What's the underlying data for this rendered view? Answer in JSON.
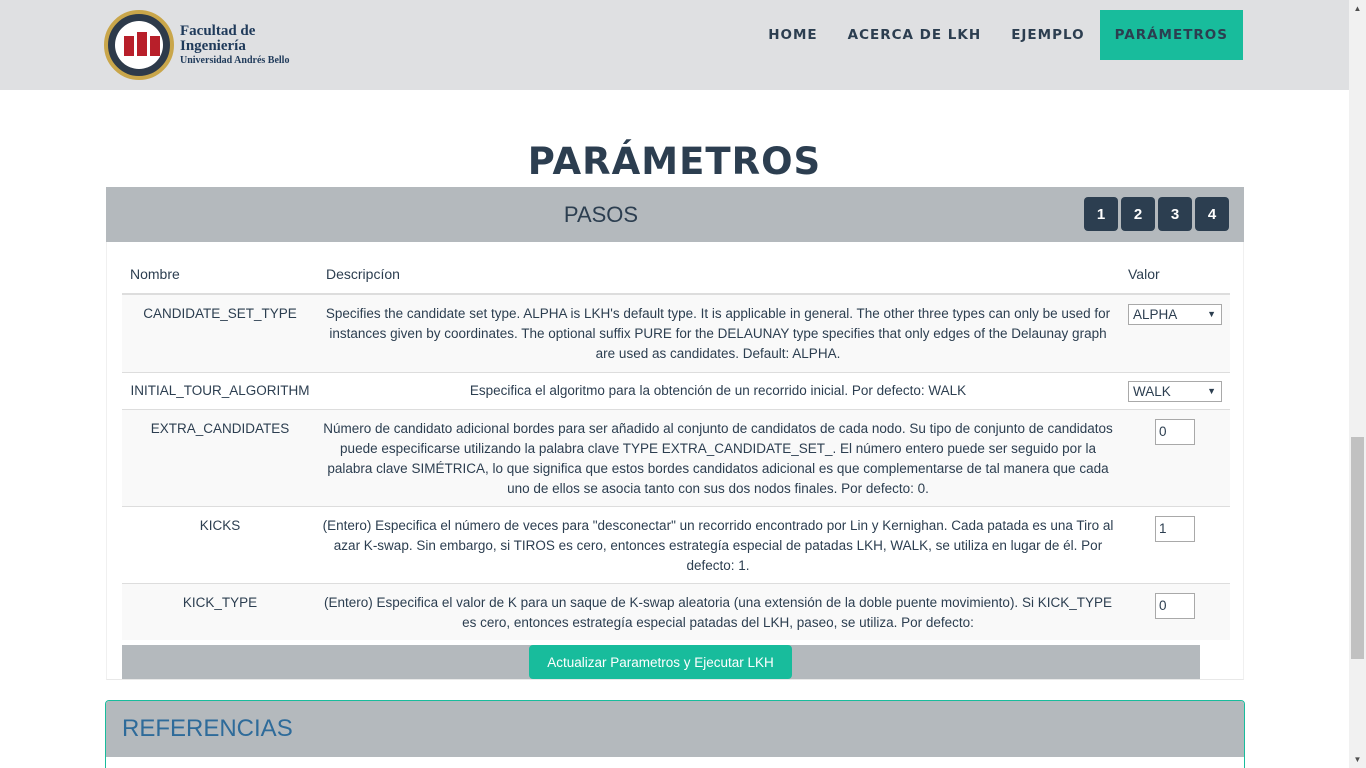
{
  "logo": {
    "line1": "Facultad de",
    "line2": "Ingeniería",
    "line3": "Universidad Andrés Bello"
  },
  "nav": {
    "items": [
      "HOME",
      "ACERCA DE LKH",
      "EJEMPLO",
      "PARÁMETROS"
    ],
    "active": "PARÁMETROS"
  },
  "page_title": "PARÁMETROS",
  "pasos": {
    "label": "PASOS",
    "steps": [
      "1",
      "2",
      "3",
      "4"
    ]
  },
  "table": {
    "headers": {
      "name": "Nombre",
      "desc": "Descripcíon",
      "value": "Valor"
    },
    "rows": [
      {
        "name": "CANDIDATE_SET_TYPE",
        "desc": "Specifies the candidate set type. ALPHA is LKH's default type. It is applicable in general. The other three types can only be used for instances given by coordinates. The optional suffix PURE for the DELAUNAY type specifies that only edges of the Delaunay graph are used as candidates. Default: ALPHA.",
        "value": "ALPHA"
      },
      {
        "name": "INITIAL_TOUR_ALGORITHM",
        "desc": "Especifica el algoritmo para la obtención de un recorrido inicial. Por defecto: WALK",
        "value": "WALK"
      },
      {
        "name": "EXTRA_CANDIDATES",
        "desc": "Número de candidato adicional bordes para ser añadido al conjunto de candidatos de cada nodo. Su tipo de conjunto de candidatos puede especificarse utilizando la palabra clave TYPE EXTRA_CANDIDATE_SET_. El número entero puede ser seguido por la palabra clave SIMÉTRICA, lo que significa que estos bordes candidatos adicional es que complementarse de tal manera que cada uno de ellos se asocia tanto con sus dos nodos finales. Por defecto: 0.",
        "value": "0"
      },
      {
        "name": "KICKS",
        "desc": "(Entero) Especifica el número de veces para \"desconectar\" un recorrido encontrado por Lin y Kernighan. Cada patada es una Tiro al azar K-swap. Sin embargo, si TIROS es cero, entonces estrategía especial de patadas LKH, WALK, se utiliza en lugar de él. Por defecto: 1.",
        "value": "1"
      },
      {
        "name": "KICK_TYPE",
        "desc": "(Entero) Especifica el valor de K para un saque de K-swap aleatoria (una extensión de la doble puente movimiento). Si KICK_TYPE es cero, entonces estrategía especial patadas del LKH, paseo, se utiliza. Por defecto:",
        "value": "0"
      }
    ]
  },
  "action_button": "Actualizar Parametros y Ejecutar LKH",
  "references": {
    "title": "REFERENCIAS"
  },
  "colors": {
    "accent": "#18bc9c",
    "navbar_bg": "#dfe0e2",
    "bar_bg": "#b4b9bd",
    "dark": "#2c3e50",
    "ref_title": "#2e6b9a"
  }
}
